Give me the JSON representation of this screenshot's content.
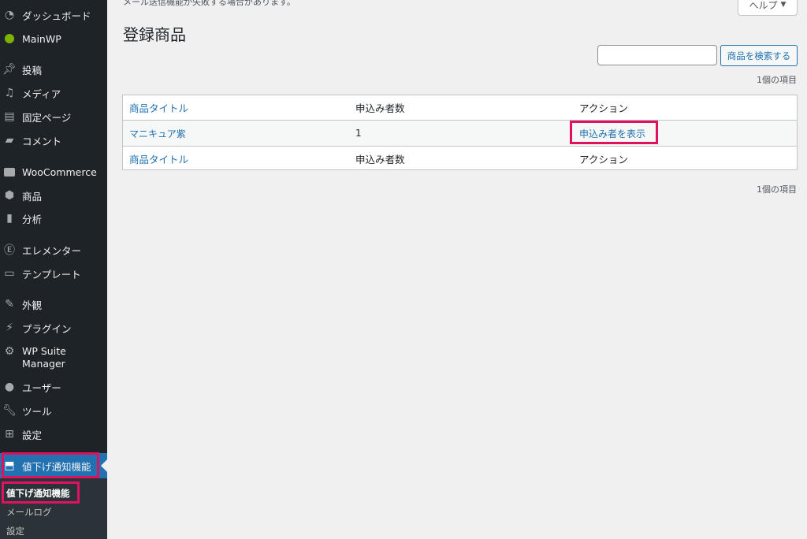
{
  "sidebar": {
    "items": [
      {
        "label": "ダッシュボード",
        "icon": "dashboard-icon"
      },
      {
        "label": "MainWP",
        "icon": "mainwp-icon"
      },
      {
        "label": "投稿",
        "icon": "pin-icon"
      },
      {
        "label": "メディア",
        "icon": "media-icon"
      },
      {
        "label": "固定ページ",
        "icon": "page-icon"
      },
      {
        "label": "コメント",
        "icon": "comment-icon"
      },
      {
        "label": "WooCommerce",
        "icon": "woocommerce-icon"
      },
      {
        "label": "商品",
        "icon": "box-icon"
      },
      {
        "label": "分析",
        "icon": "chart-icon"
      },
      {
        "label": "エレメンター",
        "icon": "elementor-icon"
      },
      {
        "label": "テンプレート",
        "icon": "folder-icon"
      },
      {
        "label": "外観",
        "icon": "brush-icon"
      },
      {
        "label": "プラグイン",
        "icon": "plugin-icon"
      },
      {
        "label": "WP Suite Manager",
        "icon": "gear-icon"
      },
      {
        "label": "ユーザー",
        "icon": "user-icon"
      },
      {
        "label": "ツール",
        "icon": "wrench-icon"
      },
      {
        "label": "設定",
        "icon": "settings-icon"
      },
      {
        "label": "値下げ通知機能",
        "icon": "price-drop-icon"
      }
    ],
    "submenu": [
      {
        "label": "値下げ通知機能"
      },
      {
        "label": "メールログ"
      },
      {
        "label": "設定"
      }
    ]
  },
  "main": {
    "notice": "メール送信機能が失敗する場合があります。",
    "help_label": "ヘルプ",
    "title": "登録商品",
    "search_button": "商品を検索する",
    "count_top": "1個の項目",
    "count_bottom": "1個の項目",
    "table": {
      "headers": [
        "商品タイトル",
        "申込み者数",
        "アクション"
      ],
      "rows": [
        {
          "title": "マニキュア紫",
          "count": "1",
          "action": "申込み者を表示"
        }
      ],
      "footers": [
        "商品タイトル",
        "申込み者数",
        "アクション"
      ]
    }
  },
  "colors": {
    "sidebar_bg": "#1d2327",
    "accent": "#2271b1",
    "highlight": "#e0115f"
  }
}
